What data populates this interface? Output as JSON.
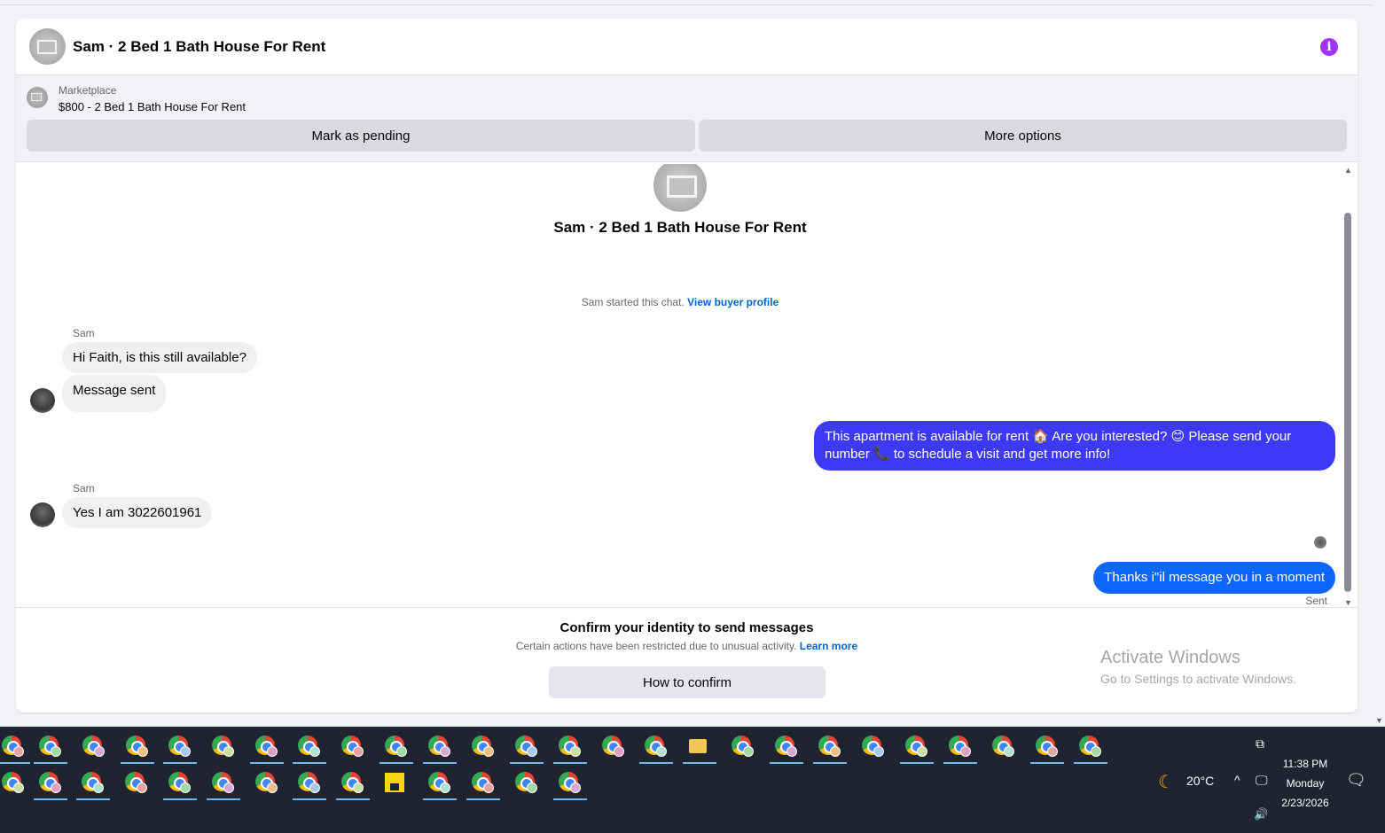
{
  "header": {
    "title": "Sam · 2 Bed 1 Bath House For Rent",
    "info_icon": "info-icon"
  },
  "marketplace": {
    "label": "Marketplace",
    "listing": "$800 - 2 Bed 1 Bath House For Rent",
    "mark_pending_label": "Mark as pending",
    "more_options_label": "More options"
  },
  "chat": {
    "title": "Sam · 2 Bed 1 Bath House For Rent",
    "started_text": "Sam started this chat.",
    "view_profile_label": "View buyer profile",
    "messages": [
      {
        "sender": "Sam",
        "text": "Hi Faith, is this still available?",
        "direction": "in"
      },
      {
        "text": "Message sent",
        "direction": "in"
      },
      {
        "text": "This apartment is available for rent 🏠 Are you interested? 😊 Please send your number 📞 to schedule a visit and get more info!",
        "direction": "out"
      },
      {
        "sender": "Sam",
        "text": "Yes I am 3022601961",
        "direction": "in"
      },
      {
        "text": "Thanks i\"il message you in a moment",
        "direction": "out"
      }
    ],
    "sent_status": "Sent"
  },
  "confirm": {
    "title": "Confirm your identity to send messages",
    "subtitle": "Certain actions have been restricted due to unusual activity.",
    "learn_more_label": "Learn more",
    "button_label": "How to confirm"
  },
  "watermark": {
    "line1": "Activate Windows",
    "line2": "Go to Settings to activate Windows."
  },
  "taskbar": {
    "weather_icon": "moon-icon",
    "temperature": "20°C",
    "time": "11:38 PM",
    "day": "Monday",
    "date": "2/23/2026"
  },
  "colors": {
    "outgoing_bubble_1": "#3d39f6",
    "outgoing_bubble_2": "#0c66ff",
    "link": "#0064d1",
    "info_icon": "#a033ff"
  }
}
